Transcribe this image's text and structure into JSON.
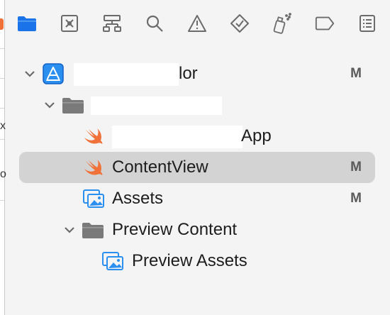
{
  "toolbar": {
    "icons": [
      {
        "name": "folder-icon",
        "label": "Project navigator",
        "active": true
      },
      {
        "name": "source-control-icon",
        "label": "Source control navigator"
      },
      {
        "name": "hierarchy-icon",
        "label": "Symbol navigator"
      },
      {
        "name": "search-icon",
        "label": "Find navigator"
      },
      {
        "name": "warning-icon",
        "label": "Issue navigator"
      },
      {
        "name": "test-diamond-icon",
        "label": "Test navigator"
      },
      {
        "name": "debug-spray-icon",
        "label": "Debug navigator"
      },
      {
        "name": "tag-icon",
        "label": "Breakpoint navigator"
      },
      {
        "name": "report-list-icon",
        "label": "Report navigator"
      }
    ],
    "accent": "#1a73e8"
  },
  "outline": {
    "project_row": {
      "label_suffix": "lor",
      "badge": "M"
    },
    "group_row": {
      "label": ""
    },
    "app_row": {
      "label_suffix": "App"
    },
    "content_view_row": {
      "label": "ContentView",
      "badge": "M"
    },
    "assets_row": {
      "label": "Assets",
      "badge": "M"
    },
    "preview_content_row": {
      "label": "Preview Content"
    },
    "preview_assets_row": {
      "label": "Preview Assets"
    }
  },
  "colors": {
    "swift_orange": "#f0713a",
    "asset_blue": "#2b8ff0",
    "folder_gray": "#7a7a7a",
    "selection_gray": "#d3d3d3"
  }
}
